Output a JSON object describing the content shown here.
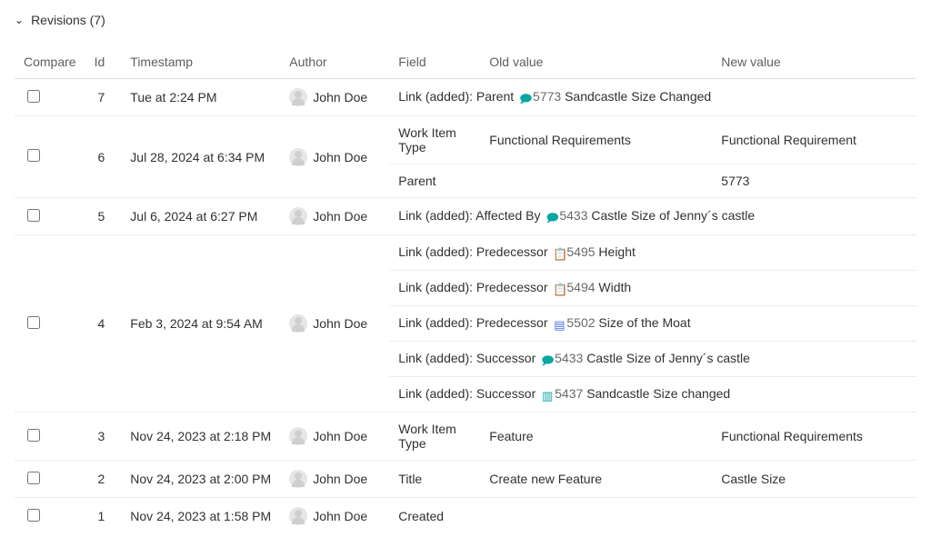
{
  "header": {
    "title": "Revisions (7)"
  },
  "columns": {
    "compare": "Compare",
    "id": "Id",
    "timestamp": "Timestamp",
    "author": "Author",
    "field": "Field",
    "old": "Old value",
    "new": "New value"
  },
  "icons": {
    "bubble": "🗩",
    "badge": "📋",
    "news": "▤",
    "books": "▥"
  },
  "revisions": [
    {
      "id": "7",
      "timestamp": "Tue at 2:24 PM",
      "author": "John Doe",
      "rows": [
        {
          "link_prefix": "Link (added): Parent",
          "icon": "bubble",
          "wid": "5773",
          "link_title": "Sandcastle Size Changed"
        }
      ]
    },
    {
      "id": "6",
      "timestamp": "Jul 28, 2024 at 6:34 PM",
      "author": "John Doe",
      "rows": [
        {
          "field": "Work Item Type",
          "old": "Functional Requirements",
          "new": "Functional Requirement"
        },
        {
          "field": "Parent",
          "old": "",
          "new": "5773"
        }
      ]
    },
    {
      "id": "5",
      "timestamp": "Jul 6, 2024 at 6:27 PM",
      "author": "John Doe",
      "rows": [
        {
          "link_prefix": "Link (added): Affected By",
          "icon": "bubble",
          "wid": "5433",
          "link_title": "Castle Size of Jenny´s castle"
        }
      ]
    },
    {
      "id": "4",
      "timestamp": "Feb 3, 2024 at 9:54 AM",
      "author": "John Doe",
      "rows": [
        {
          "link_prefix": "Link (added): Predecessor",
          "icon": "badge",
          "wid": "5495",
          "link_title": "Height"
        },
        {
          "link_prefix": "Link (added): Predecessor",
          "icon": "badge",
          "wid": "5494",
          "link_title": "Width"
        },
        {
          "link_prefix": "Link (added): Predecessor",
          "icon": "news",
          "wid": "5502",
          "link_title": "Size of the Moat"
        },
        {
          "link_prefix": "Link (added): Successor",
          "icon": "bubble",
          "wid": "5433",
          "link_title": "Castle Size of Jenny´s castle"
        },
        {
          "link_prefix": "Link (added): Successor",
          "icon": "books",
          "wid": "5437",
          "link_title": "Sandcastle Size changed"
        }
      ]
    },
    {
      "id": "3",
      "timestamp": "Nov 24, 2023 at 2:18 PM",
      "author": "John Doe",
      "rows": [
        {
          "field": "Work Item Type",
          "old": "Feature",
          "new": "Functional Requirements"
        }
      ]
    },
    {
      "id": "2",
      "timestamp": "Nov 24, 2023 at 2:00 PM",
      "author": "John Doe",
      "rows": [
        {
          "field": "Title",
          "old": "Create new Feature",
          "new": "Castle Size"
        }
      ]
    },
    {
      "id": "1",
      "timestamp": "Nov 24, 2023 at 1:58 PM",
      "author": "John Doe",
      "rows": [
        {
          "field": "Created",
          "old": "",
          "new": ""
        }
      ]
    }
  ]
}
